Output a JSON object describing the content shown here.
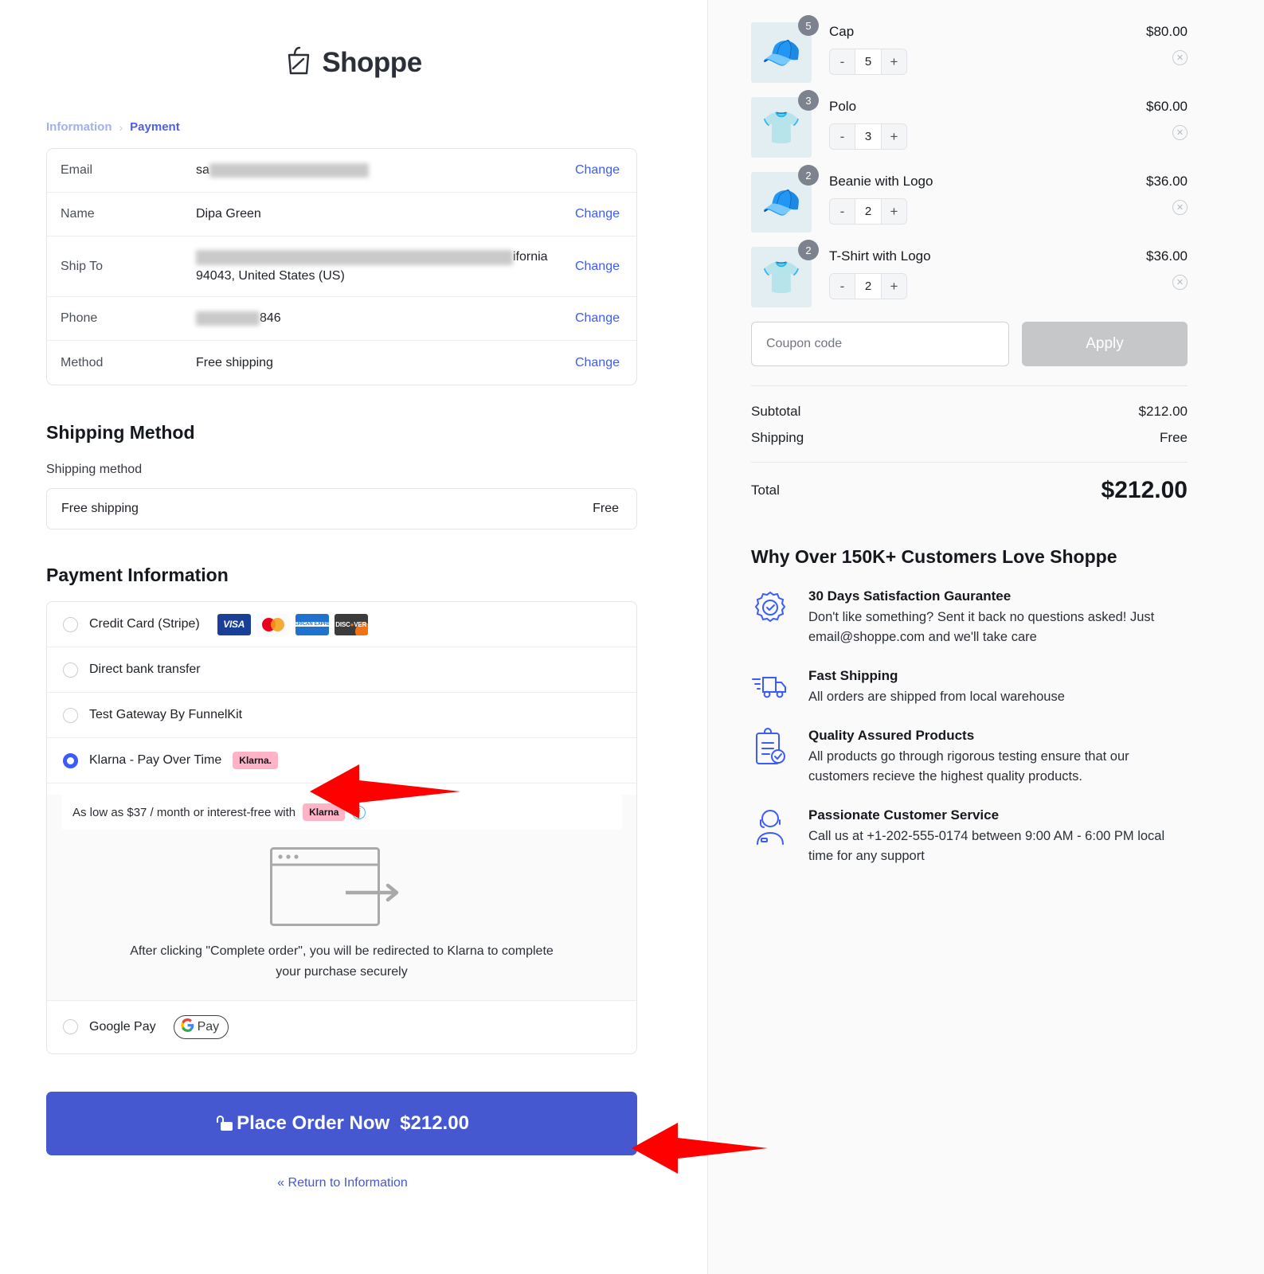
{
  "brand": {
    "name": "Shoppe",
    "logo_icon": "shopping-bag-icon"
  },
  "breadcrumb": {
    "previous": "Information",
    "separator": "›",
    "current": "Payment"
  },
  "info_table": {
    "change_label": "Change",
    "rows": [
      {
        "label": "Email",
        "value": "sa",
        "redacted": true
      },
      {
        "label": "Name",
        "value": "Dipa Green",
        "redacted": false
      },
      {
        "label": "Ship To",
        "value": "ifornia",
        "value_line2": "94043, United States (US)",
        "redacted": true
      },
      {
        "label": "Phone",
        "value": "846",
        "redacted": true
      },
      {
        "label": "Method",
        "value": "Free shipping",
        "redacted": false
      }
    ]
  },
  "shipping": {
    "heading": "Shipping Method",
    "field_label": "Shipping method",
    "option_name": "Free shipping",
    "option_price": "Free"
  },
  "payment": {
    "heading": "Payment Information",
    "methods": [
      {
        "label": "Credit Card (Stripe)",
        "selected": false,
        "cards": [
          "VISA",
          "mastercard",
          "AMERICAN EXPRESS",
          "DISCOVER"
        ]
      },
      {
        "label": "Direct bank transfer",
        "selected": false
      },
      {
        "label": "Test Gateway By FunnelKit",
        "selected": false
      },
      {
        "label": "Klarna - Pay Over Time",
        "selected": true,
        "badge": "Klarna."
      },
      {
        "label": "Google Pay",
        "selected": false,
        "gpay_badge": "Pay"
      }
    ],
    "klarna_panel": {
      "osm_text": "As low as $37 / month or interest-free with",
      "osm_badge": "Klarna",
      "info_icon": "info-circle-icon",
      "illustration_icon": "browser-redirect-icon",
      "redirect_note": "After clicking \"Complete order\", you will be redirected to Klarna to complete your purchase securely"
    }
  },
  "place_order": {
    "lock_icon": "lock-icon",
    "label": "Place Order Now",
    "amount": "$212.00"
  },
  "return_link": "« Return to Information",
  "cart": {
    "items": [
      {
        "name": "Cap",
        "price": "$80.00",
        "qty": "5",
        "badge": "5",
        "thumb": "🧢",
        "minus": "-",
        "plus": "+",
        "remove_icon": "remove-item-icon"
      },
      {
        "name": "Polo",
        "price": "$60.00",
        "qty": "3",
        "badge": "3",
        "thumb": "👕",
        "minus": "-",
        "plus": "+",
        "remove_icon": "remove-item-icon"
      },
      {
        "name": "Beanie with Logo",
        "price": "$36.00",
        "qty": "2",
        "badge": "2",
        "thumb": "🧢",
        "minus": "-",
        "plus": "+",
        "remove_icon": "remove-item-icon"
      },
      {
        "name": "T-Shirt with Logo",
        "price": "$36.00",
        "qty": "2",
        "badge": "2",
        "thumb": "👕",
        "minus": "-",
        "plus": "+",
        "remove_icon": "remove-item-icon"
      }
    ]
  },
  "coupon": {
    "placeholder": "Coupon code",
    "value": "",
    "apply_label": "Apply"
  },
  "totals": {
    "subtotal_label": "Subtotal",
    "subtotal_value": "$212.00",
    "shipping_label": "Shipping",
    "shipping_value": "Free",
    "total_label": "Total",
    "total_value": "$212.00"
  },
  "trust": {
    "heading": "Why Over 150K+ Customers Love Shoppe",
    "items": [
      {
        "icon": "satisfaction-badge-icon",
        "title": "30 Days Satisfaction Gaurantee",
        "desc": "Don't like something? Sent it back no questions asked! Just email@shoppe.com and we'll take care"
      },
      {
        "icon": "delivery-truck-icon",
        "title": "Fast Shipping",
        "desc": "All orders are shipped from local warehouse"
      },
      {
        "icon": "clipboard-check-icon",
        "title": "Quality Assured Products",
        "desc": "All products go through rigorous testing ensure that our customers recieve the highest quality products."
      },
      {
        "icon": "headset-agent-icon",
        "title": "Passionate Customer Service",
        "desc": "Call us at +1-202-555-0174 between 9:00 AM - 6:00 PM local time for any support"
      }
    ]
  },
  "annotations": {
    "arrow_color": "#FF0000",
    "arrow_count": 2
  },
  "colors": {
    "accent": "#3b5bfd",
    "cta": "#4558d0",
    "klarna_pink": "#ffb3c7",
    "arrow_red": "#ff0000"
  }
}
